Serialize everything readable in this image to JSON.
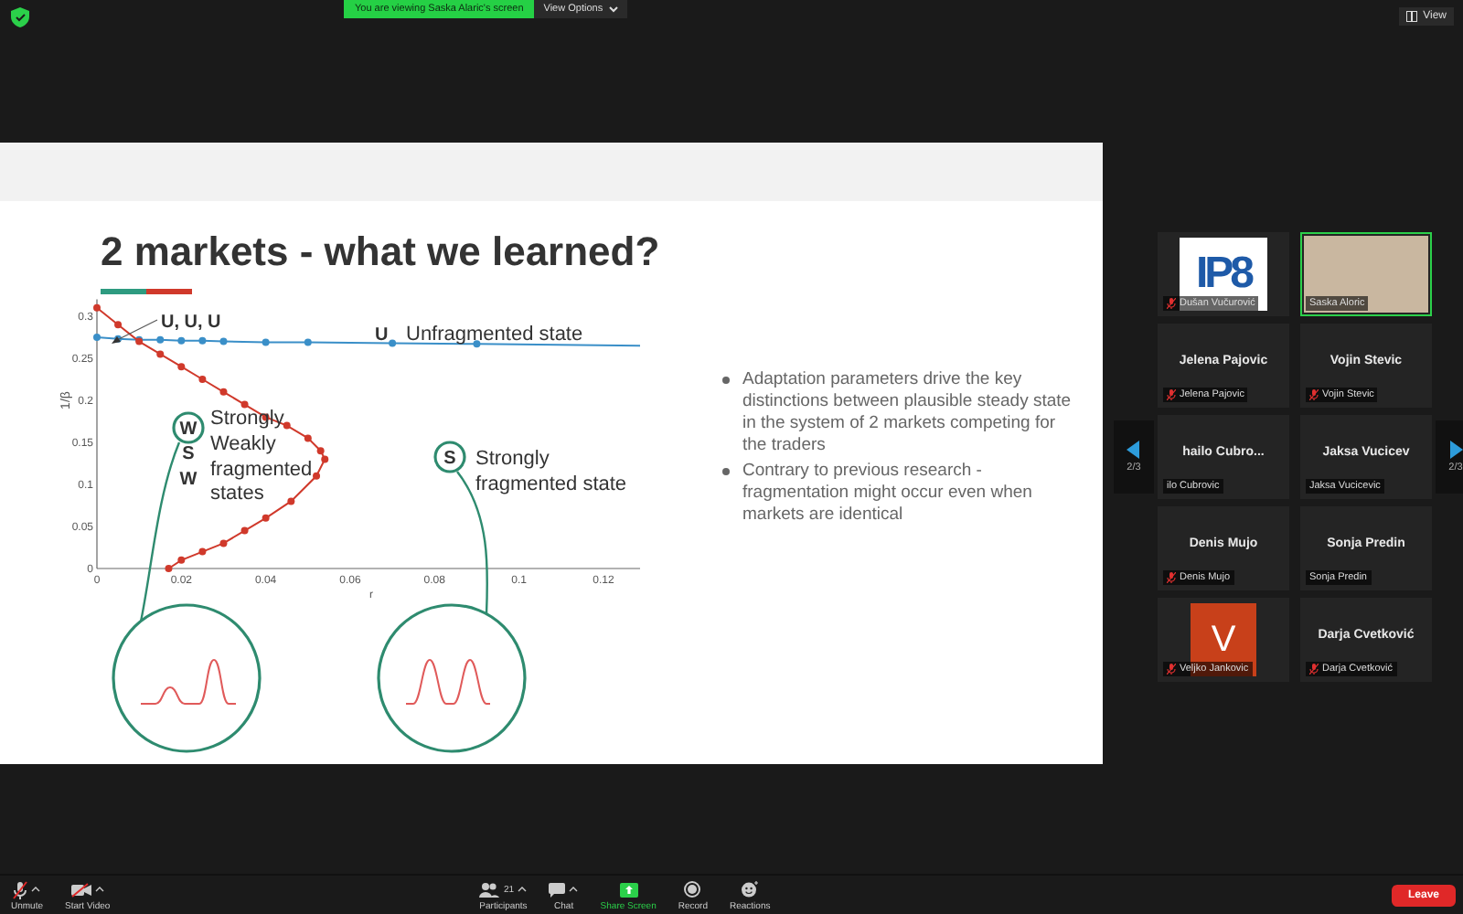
{
  "top_bar": {
    "viewing_banner": "You are viewing Saska Alaric's screen",
    "view_options": "View Options",
    "view_button": "View"
  },
  "slide": {
    "title": "2 markets - what we learned?",
    "figure": {
      "x_label": "r",
      "y_label": "1/β",
      "x_ticks": [
        "0",
        "0.02",
        "0.04",
        "0.06",
        "0.08",
        "0.1",
        "0.12"
      ],
      "y_ticks": [
        "0.3",
        "0.25",
        "0.2",
        "0.15",
        "0.1",
        "0.05",
        "0"
      ],
      "labels": [
        {
          "text": "U, U, U",
          "kind": "bold"
        },
        {
          "text": "U",
          "kind": "bold"
        },
        {
          "text": "Unfragmented state",
          "kind": "label"
        },
        {
          "text": "W",
          "kind": "badge"
        },
        {
          "text": "S",
          "kind": "bold"
        },
        {
          "text": "W",
          "kind": "bold"
        },
        {
          "text": "Strongly",
          "kind": "label"
        },
        {
          "text": "Weakly",
          "kind": "label"
        },
        {
          "text": "fragmented",
          "kind": "label"
        },
        {
          "text": "states",
          "kind": "label"
        },
        {
          "text": "S",
          "kind": "badge"
        },
        {
          "text": "Strongly",
          "kind": "label"
        },
        {
          "text": "fragmented state",
          "kind": "label"
        }
      ]
    },
    "bullets": [
      "Adaptation parameters drive the key distinctions between plausible steady state in the system of 2 markets competing for the traders",
      "Contrary to previous research - fragmentation might occur even when markets are identical"
    ]
  },
  "gallery": {
    "nav": [
      {
        "page": "2/3"
      },
      {
        "page": "2/3"
      }
    ],
    "tiles": [
      {
        "kind": "logo",
        "logo": "IP8",
        "label": "Dušan Vučurović",
        "muted": true,
        "speaking": false
      },
      {
        "kind": "video",
        "label": "Saska Aloric",
        "muted": false,
        "speaking": true
      },
      {
        "kind": "name",
        "name": "Jelena Pajovic",
        "label": "Jelena Pajovic",
        "muted": true,
        "speaking": false
      },
      {
        "kind": "name",
        "name": "Vojin Stevic",
        "label": "Vojin Stevic",
        "muted": true,
        "speaking": false
      },
      {
        "kind": "name",
        "name": "hailo Cubro...",
        "label": "ilo Cubrovic",
        "muted": false,
        "speaking": false
      },
      {
        "kind": "name",
        "name": "Jaksa Vucicev",
        "label": "Jaksa Vucicevic",
        "muted": false,
        "speaking": false
      },
      {
        "kind": "name",
        "name": "Denis Mujo",
        "label": "Denis Mujo",
        "muted": true,
        "speaking": false
      },
      {
        "kind": "name",
        "name": "Sonja Predin",
        "label": "Sonja Predin",
        "muted": false,
        "speaking": false
      },
      {
        "kind": "avatar",
        "letter": "V",
        "label": "Veljko Jankovic",
        "muted": true,
        "speaking": false
      },
      {
        "kind": "name",
        "name": "Darja Cvetković",
        "label": "Darja Cvetković",
        "muted": true,
        "speaking": false
      }
    ]
  },
  "toolbar": {
    "left": [
      {
        "kind": "mic",
        "label": "Unmute",
        "menu": true
      },
      {
        "kind": "camera",
        "label": "Start Video",
        "menu": true
      }
    ],
    "center": [
      {
        "kind": "people",
        "label": "Participants",
        "count": "21",
        "menu": true
      },
      {
        "kind": "chat",
        "label": "Chat",
        "menu": true
      },
      {
        "kind": "share",
        "label": "Share Screen",
        "menu": false
      },
      {
        "kind": "record",
        "label": "Record",
        "menu": false
      },
      {
        "kind": "reactions",
        "label": "Reactions",
        "menu": false
      }
    ],
    "leave": "Leave"
  }
}
